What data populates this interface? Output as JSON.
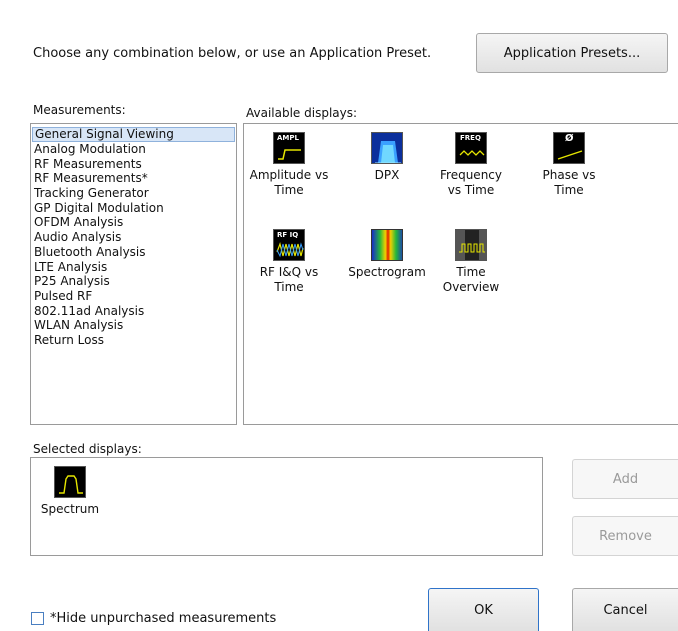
{
  "header": {
    "instruction": "Choose any combination below, or use an Application Preset.",
    "presets_button": "Application Presets..."
  },
  "measurements": {
    "label": "Measurements:",
    "items": [
      "General Signal Viewing",
      "Analog Modulation",
      "RF Measurements",
      "RF Measurements*",
      "Tracking Generator",
      "GP Digital Modulation",
      "OFDM Analysis",
      "Audio Analysis",
      "Bluetooth Analysis",
      "LTE Analysis",
      "P25 Analysis",
      "Pulsed RF",
      "802.11ad Analysis",
      "WLAN Analysis",
      "Return Loss"
    ],
    "selected": "General Signal Viewing"
  },
  "available": {
    "label": "Available displays:",
    "items": [
      {
        "label1": "Amplitude vs",
        "label2": "Time",
        "icon": "amplitude-icon",
        "caption": "AMPL"
      },
      {
        "label1": "DPX",
        "label2": "",
        "icon": "dpx-icon",
        "caption": ""
      },
      {
        "label1": "Frequency",
        "label2": "vs Time",
        "icon": "frequency-icon",
        "caption": "FREQ"
      },
      {
        "label1": "Phase vs",
        "label2": "Time",
        "icon": "phase-icon",
        "caption": "Ø"
      },
      {
        "label1": "RF I&Q vs",
        "label2": "Time",
        "icon": "rf-iq-icon",
        "caption": "RF IQ"
      },
      {
        "label1": "Spectrogram",
        "label2": "",
        "icon": "spectrogram-icon",
        "caption": ""
      },
      {
        "label1": "Time",
        "label2": "Overview",
        "icon": "time-overview-icon",
        "caption": ""
      }
    ]
  },
  "selected_displays": {
    "label": "Selected displays:",
    "items": [
      {
        "label": "Spectrum",
        "icon": "spectrum-icon"
      }
    ]
  },
  "buttons": {
    "add": "Add",
    "remove": "Remove",
    "ok": "OK",
    "cancel": "Cancel"
  },
  "hide_unpurchased": {
    "label": "*Hide unpurchased measurements",
    "checked": false
  },
  "colors": {
    "accent": "#2f73c9",
    "selection": "#d8e6f7",
    "trace_yellow": "#e6e600"
  }
}
